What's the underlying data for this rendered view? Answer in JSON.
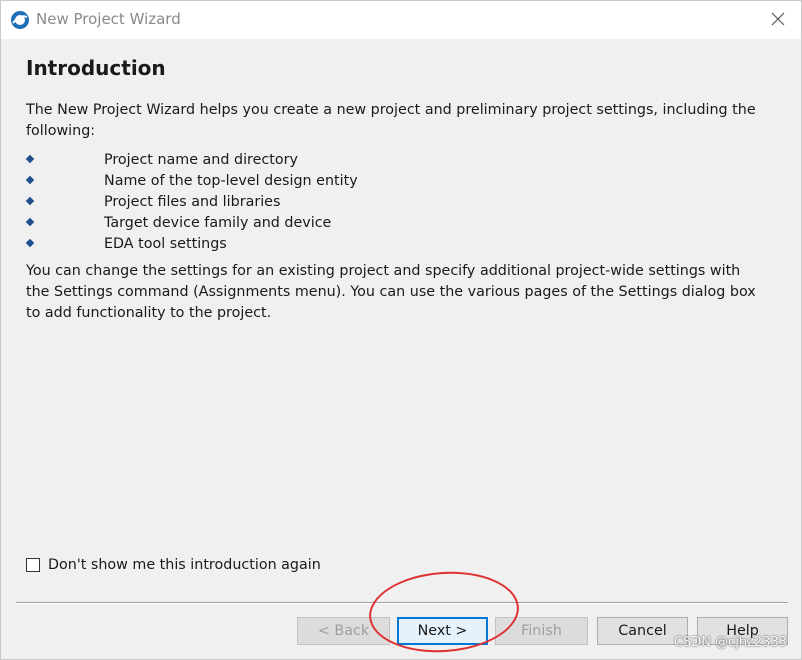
{
  "window": {
    "title": "New Project Wizard",
    "icon": "quartus-globe-icon"
  },
  "page": {
    "heading": "Introduction",
    "intro": "The New Project Wizard helps you create a new project and preliminary project settings, including the following:",
    "bullets": [
      "Project name and directory",
      "Name of the top-level design entity",
      "Project files and libraries",
      "Target device family and device",
      "EDA tool settings"
    ],
    "outro": "You can change the settings for an existing project and specify additional project-wide settings with the Settings command (Assignments menu). You can use the various pages of the Settings dialog box to add functionality to the project."
  },
  "checkbox": {
    "label": "Don't show me this introduction again",
    "checked": false
  },
  "buttons": {
    "back": "< Back",
    "next": "Next >",
    "finish": "Finish",
    "cancel": "Cancel",
    "help": "Help"
  },
  "watermark": "CSDN @cjhz2333",
  "colors": {
    "accent": "#0078d7",
    "annotation": "#e03030"
  }
}
